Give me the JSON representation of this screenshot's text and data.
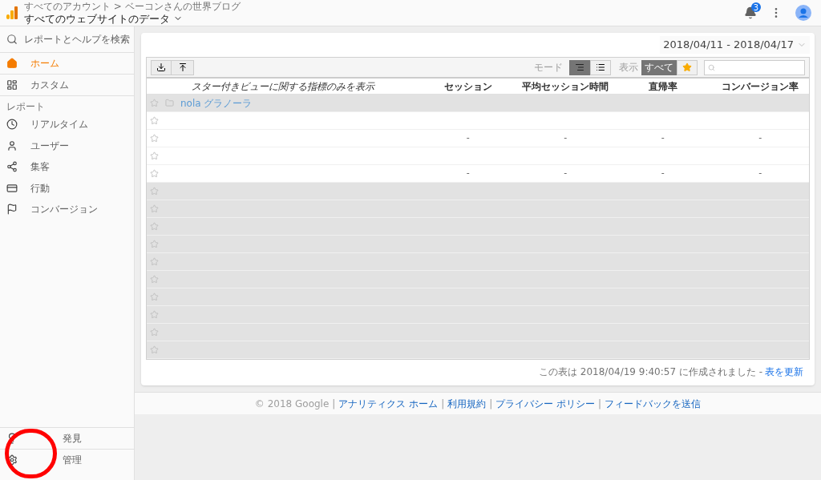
{
  "header": {
    "breadcrumb": "すべてのアカウント > ベーコンさんの世界ブログ",
    "title": "すべてのウェブサイトのデータ",
    "notifications": "3"
  },
  "sidebar": {
    "search": "レポートとヘルプを検索",
    "items": [
      {
        "label": "ホーム",
        "selected": true
      },
      {
        "label": "カスタム",
        "selected": false
      }
    ],
    "section": "レポート",
    "reports": [
      {
        "label": "リアルタイム"
      },
      {
        "label": "ユーザー"
      },
      {
        "label": "集客"
      },
      {
        "label": "行動"
      },
      {
        "label": "コンバージョン"
      }
    ],
    "bottom": [
      {
        "label": "発見"
      },
      {
        "label": "管理"
      }
    ]
  },
  "date_range": "2018/04/11 - 2018/04/17",
  "toolbar": {
    "mode_label": "モード",
    "view_label": "表示",
    "view_all": "すべて",
    "view_all_selected": true
  },
  "table": {
    "columns": [
      "スター付きビューに関する指標のみを表示",
      "セッション",
      "平均セッション時間",
      "直帰率",
      "コンバージョン率"
    ],
    "rows": [
      {
        "kind": "account",
        "shaded": true,
        "cells": [
          "nola グラノーラ"
        ]
      },
      {
        "kind": "view",
        "shaded": false
      },
      {
        "kind": "view",
        "shaded": false,
        "cells": [
          "",
          "-",
          "-",
          "-",
          "-"
        ]
      },
      {
        "kind": "view",
        "shaded": false
      },
      {
        "kind": "view",
        "shaded": false,
        "cells": [
          "",
          "-",
          "-",
          "-",
          "-"
        ]
      },
      {
        "kind": "view",
        "shaded": true
      },
      {
        "kind": "view",
        "shaded": true
      },
      {
        "kind": "view",
        "shaded": true
      },
      {
        "kind": "view",
        "shaded": true
      },
      {
        "kind": "view",
        "shaded": true
      },
      {
        "kind": "view",
        "shaded": true
      },
      {
        "kind": "view",
        "shaded": true
      },
      {
        "kind": "view",
        "shaded": true
      },
      {
        "kind": "view",
        "shaded": true
      },
      {
        "kind": "view",
        "shaded": true
      }
    ]
  },
  "table_note": "この表は 2018/04/19 9:40:57 に作成されました -",
  "table_note_link": "表を更新",
  "footer": {
    "copyright": "© 2018 Google",
    "separator": "|",
    "links": [
      "アナリティクス ホーム",
      "利用規約",
      "プライバシー ポリシー",
      "フィードバックを送信"
    ]
  }
}
